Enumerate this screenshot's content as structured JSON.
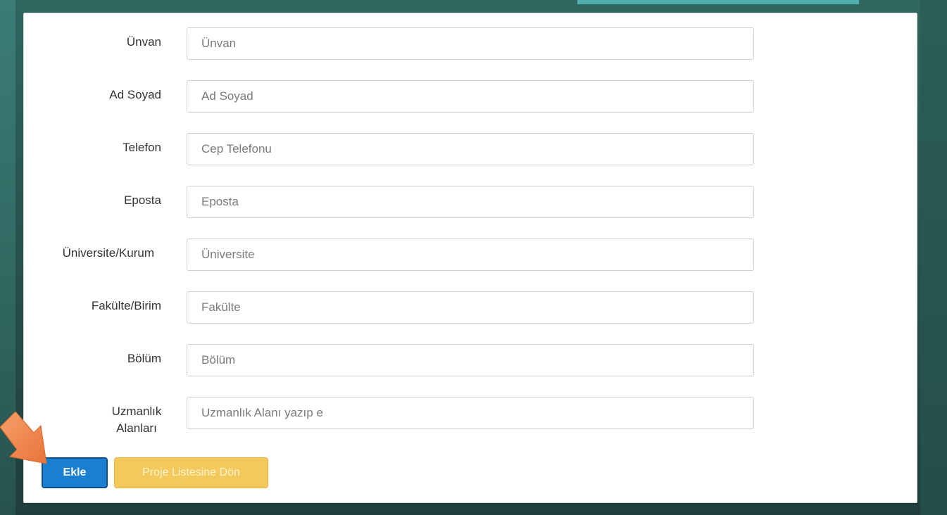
{
  "form": {
    "fields": [
      {
        "label": "Ünvan",
        "placeholder": "Ünvan"
      },
      {
        "label": "Ad Soyad",
        "placeholder": "Ad Soyad"
      },
      {
        "label": "Telefon",
        "placeholder": "Cep Telefonu"
      },
      {
        "label": "Eposta",
        "placeholder": "Eposta"
      },
      {
        "label": "Üniversite/Kurum",
        "placeholder": "Üniversite"
      },
      {
        "label": "Fakülte/Birim",
        "placeholder": "Fakülte"
      },
      {
        "label": "Bölüm",
        "placeholder": "Bölüm"
      },
      {
        "label_line1": "Uzmanlık",
        "label_line2": "Alanları",
        "placeholder": "Uzmanlık Alanı yazıp e"
      }
    ]
  },
  "actions": {
    "add_label": "Ekle",
    "back_label": "Proje Listesine Dön"
  },
  "annotation": {
    "arrow_icon": "arrow-pointer-icon",
    "arrow_color": "#f08a4b"
  },
  "colors": {
    "primary": "#1a7fd1",
    "warning": "#f4c95b",
    "background": "#2e6660"
  }
}
